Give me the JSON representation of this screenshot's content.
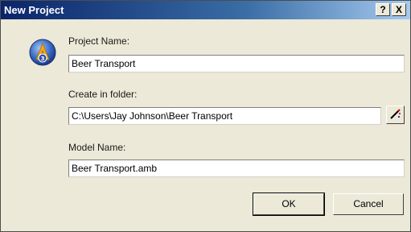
{
  "window": {
    "title": "New Project",
    "help_label": "?",
    "close_label": "X"
  },
  "form": {
    "project_name_label": "Project Name:",
    "project_name_value": "Beer Transport",
    "folder_label": "Create in folder:",
    "folder_value": "C:\\Users\\Jay Johnson\\Beer Transport",
    "model_name_label": "Model Name:",
    "model_name_value": "Beer Transport.amb"
  },
  "buttons": {
    "ok_label": "OK",
    "cancel_label": "Cancel"
  },
  "icons": {
    "app_icon": "arena-app-icon",
    "browse_icon": "magic-wand-icon"
  },
  "colors": {
    "titlebar_start": "#0a246a",
    "titlebar_end": "#a6caf0",
    "dialog_bg": "#ece9d8"
  }
}
